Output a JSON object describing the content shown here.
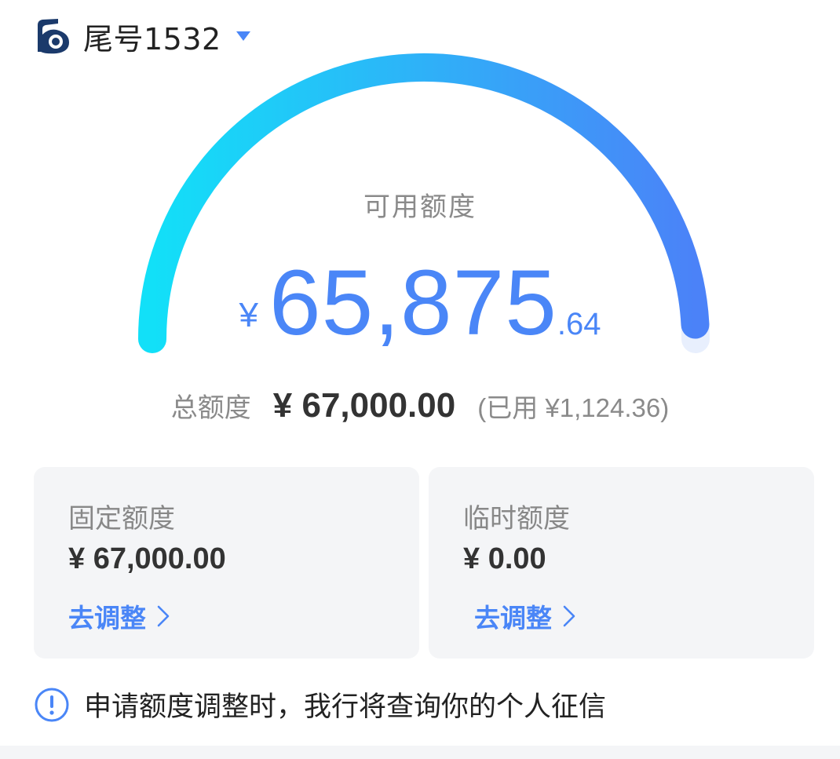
{
  "header": {
    "card_label": "尾号1532",
    "logo_icon": "bank-logo-icon",
    "dropdown_icon": "caret-down-icon"
  },
  "gauge": {
    "title": "可用额度",
    "currency": "¥",
    "amount_int": "65,875",
    "amount_dec": ".64",
    "available": 65875.64,
    "total": 67000,
    "fill_fraction": 0.983,
    "gradient_start": "#12e0f8",
    "gradient_end": "#4b82f8",
    "track_color": "#e8effd"
  },
  "total": {
    "label": "总额度",
    "value": "¥ 67,000.00",
    "used": "(已用 ¥1,124.36)"
  },
  "quota_cards": [
    {
      "title": "固定额度",
      "amount": "¥ 67,000.00",
      "link": "去调整"
    },
    {
      "title": "临时额度",
      "amount": "¥ 0.00",
      "link": "去调整"
    }
  ],
  "notice": {
    "icon": "info-circle-icon",
    "text": "申请额度调整时，我行将查询你的个人征信"
  },
  "colors": {
    "accent": "#4a86f7",
    "card_bg": "#f4f5f7",
    "muted_text": "#8a8a8a",
    "logo_navy": "#1b3a6b"
  }
}
